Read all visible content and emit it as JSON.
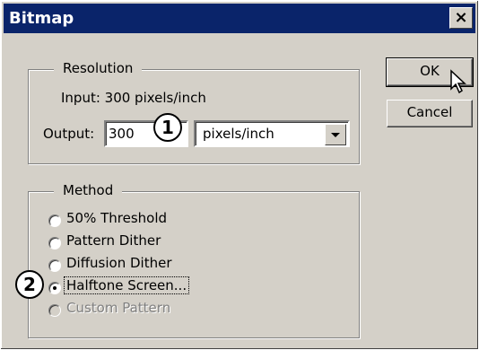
{
  "window": {
    "title": "Bitmap",
    "close_glyph": "×"
  },
  "resolution": {
    "legend": "Resolution",
    "input_text": "Input: 300 pixels/inch",
    "output_label": "Output:",
    "output_value": "300",
    "unit_selected": "pixels/inch"
  },
  "buttons": {
    "ok": "OK",
    "cancel": "Cancel"
  },
  "method": {
    "legend": "Method",
    "options": [
      {
        "label": "50% Threshold",
        "checked": false,
        "disabled": false
      },
      {
        "label": "Pattern Dither",
        "checked": false,
        "disabled": false
      },
      {
        "label": "Diffusion Dither",
        "checked": false,
        "disabled": false
      },
      {
        "label": "Halftone Screen...",
        "checked": true,
        "disabled": false
      },
      {
        "label": "Custom Pattern",
        "checked": false,
        "disabled": true
      }
    ]
  },
  "callouts": [
    "1",
    "2"
  ]
}
